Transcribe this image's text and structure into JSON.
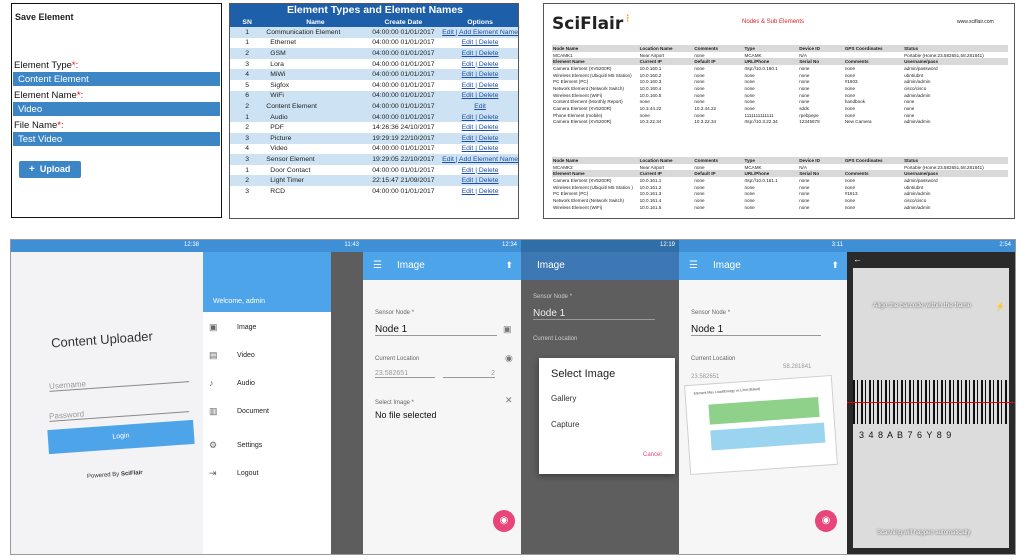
{
  "save_form": {
    "title": "Save Element",
    "fields": [
      {
        "label": "Element Type",
        "value": "Content Element"
      },
      {
        "label": "Element Name",
        "value": "Video"
      },
      {
        "label": "File Name",
        "value": "Test Video"
      }
    ],
    "required_mark": "*:",
    "upload_label": "Upload",
    "upload_icon": "plus-icon"
  },
  "types_table": {
    "title": "Element Types and Element Names",
    "columns": [
      "SN",
      "Name",
      "Create Date",
      "Options"
    ],
    "rows": [
      {
        "sn": "1",
        "toggle": "▾",
        "name": "Communication Element",
        "date": "04:00:00 01/01/2017",
        "options": "Edit | Add Element Name",
        "group": true
      },
      {
        "sn": "1",
        "name": "Ethernet",
        "date": "04:00:00 01/01/2017",
        "options": "Edit | Delete"
      },
      {
        "sn": "2",
        "name": "GSM",
        "date": "04:00:00 01/01/2017",
        "options": "Edit | Delete"
      },
      {
        "sn": "3",
        "name": "Lora",
        "date": "04:00:00 01/01/2017",
        "options": "Edit | Delete"
      },
      {
        "sn": "4",
        "name": "MiWi",
        "date": "04:00:00 01/01/2017",
        "options": "Edit | Delete"
      },
      {
        "sn": "5",
        "name": "Sigfox",
        "date": "04:00:00 01/01/2017",
        "options": "Edit | Delete"
      },
      {
        "sn": "6",
        "name": "WiFi",
        "date": "04:00:00 01/01/2017",
        "options": "Edit | Delete"
      },
      {
        "sn": "2",
        "toggle": "▾",
        "name": "Content Element",
        "date": "04:00:00 01/01/2017",
        "options": "Edit",
        "group": true
      },
      {
        "sn": "1",
        "name": "Audio",
        "date": "04:00:00 01/01/2017",
        "options": "Edit | Delete"
      },
      {
        "sn": "2",
        "name": "PDF",
        "date": "14:26:36 24/10/2017",
        "options": "Edit | Delete"
      },
      {
        "sn": "3",
        "name": "Picture",
        "date": "19:29:19 22/10/2017",
        "options": "Edit | Delete"
      },
      {
        "sn": "4",
        "name": "Video",
        "date": "04:00:00 01/01/2017",
        "options": "Edit | Delete"
      },
      {
        "sn": "3",
        "toggle": "▾",
        "name": "Sensor Element",
        "date": "19:29:05 22/10/2017",
        "options": "Edit | Add Element Name",
        "group": true
      },
      {
        "sn": "1",
        "name": "Door Contact",
        "date": "04:00:00 01/01/2017",
        "options": "Edit | Delete"
      },
      {
        "sn": "2",
        "name": "Light Timer",
        "date": "22:15:47 21/09/2017",
        "options": "Edit | Delete"
      },
      {
        "sn": "3",
        "name": "RCD",
        "date": "04:00:00 01/01/2017",
        "options": "Edit | Delete"
      }
    ]
  },
  "report": {
    "logo": "SciFlair",
    "title": "Nodes & Sub Elements",
    "website": "www.sciflair.com",
    "blocks": [
      {
        "node_header": [
          "Node Name",
          "Location Name",
          "Comments",
          "Type",
          "Device ID",
          "GPS Coordinates",
          "Status"
        ],
        "node_row": [
          "MCAMK1",
          "Near Airport",
          "none",
          "MCAMK",
          "N/A",
          "",
          "Portable (Home:23.582651,58.281841)"
        ],
        "el_header": [
          "Element Name",
          "Current IP",
          "Default IP",
          "URL/Phone",
          "Serial No",
          "Comments",
          "Username/pass"
        ],
        "rows": [
          [
            "Camera Element (XV5200R)",
            "10.0.160.1",
            "none",
            "rtsp://10.0.160.1",
            "none",
            "none",
            "admin/password"
          ],
          [
            "Wireless Element (Ubiquiti M5 Station)",
            "10.0.160.2",
            "none",
            "none",
            "none",
            "none",
            "ubnt/ubnt"
          ],
          [
            "PC Element (PC)",
            "10.0.160.3",
            "none",
            "none",
            "none",
            "#1603",
            "admin/admin"
          ],
          [
            "Network Element (Network Switch)",
            "10.0.160.4",
            "none",
            "none",
            "none",
            "none",
            "cisco/cisco"
          ],
          [
            "Wireless Element (WiFi)",
            "10.0.160.5",
            "none",
            "none",
            "none",
            "none",
            "admin/admin"
          ],
          [
            "Content Element (Monthly Report)",
            "none",
            "none",
            "none",
            "none",
            "handbook",
            "none"
          ],
          [
            "Camera Element (XV5200R)",
            "10.3.44.22",
            "10.3.44.22",
            "none",
            "sdds",
            "none",
            "none"
          ],
          [
            "Phone Element (mobile)",
            "none",
            "none",
            "1111111111111",
            "rpebpepe",
            "none",
            "none"
          ],
          [
            "Camera Element (XV5200R)",
            "10.3.22.34",
            "10.3.22.34",
            "rtsp://10.3.22.34",
            "12345678",
            "New Camera",
            "admin/admin"
          ]
        ]
      },
      {
        "node_header": [
          "Node Name",
          "Location Name",
          "Comments",
          "Type",
          "Device ID",
          "GPS Coordinates",
          "Status"
        ],
        "node_row": [
          "MCAMK2",
          "Near Airport",
          "none",
          "MCAMK",
          "N/A",
          "",
          "Portable (Home:23.582651,58.281841)"
        ],
        "el_header": [
          "Element Name",
          "Current IP",
          "Default IP",
          "URL/Phone",
          "Serial No",
          "Comments",
          "Username/pass"
        ],
        "rows": [
          [
            "Camera Element (XV5200R)",
            "10.0.161.1",
            "none",
            "rtsp://10.0.161.1",
            "none",
            "none",
            "admin/password"
          ],
          [
            "Wireless Element (Ubiquiti M5 Station )",
            "10.0.161.2",
            "none",
            "none",
            "none",
            "none",
            "ubnt/ubnt"
          ],
          [
            "PC Element (PC)",
            "10.0.161.3",
            "none",
            "none",
            "none",
            "#1613",
            "admin/admin"
          ],
          [
            "Network Element (Network Switch)",
            "10.0.161.4",
            "none",
            "none",
            "none",
            "none",
            "cisco/cisco"
          ],
          [
            "Wireless Element (WiFi)",
            "10.0.161.5",
            "none",
            "none",
            "none",
            "none",
            "admin/admin"
          ]
        ]
      }
    ]
  },
  "phones": {
    "login": {
      "time": "12:38",
      "title": "Content Uploader",
      "username_placeholder": "Username",
      "password_placeholder": "Password",
      "login_label": "Login",
      "powered_by": "Powered By",
      "brand": "SciFlair"
    },
    "drawer": {
      "time": "11:43",
      "welcome": "Welcome, admin",
      "items": [
        {
          "icon": "image-icon",
          "label": "Image"
        },
        {
          "icon": "video-icon",
          "label": "Video"
        },
        {
          "icon": "audio-icon",
          "label": "Audio"
        },
        {
          "icon": "document-icon",
          "label": "Document"
        },
        {
          "icon": "gear-icon",
          "label": "Settings"
        },
        {
          "icon": "logout-icon",
          "label": "Logout"
        }
      ]
    },
    "image_form": {
      "time": "12:34",
      "title": "Image",
      "node_label": "Sensor Node *",
      "node_value": "Node 1",
      "location_label": "Current Location",
      "location_value": "23.582651",
      "location_value2": "2",
      "image_label": "Select Image *",
      "image_value": "No file selected"
    },
    "select_dialog": {
      "time": "12:19",
      "title": "Image",
      "node_label": "Sensor Node *",
      "node_value": "Node 1",
      "location_label": "Current Location",
      "dialog_title": "Select Image",
      "options": [
        "Gallery",
        "Capture"
      ],
      "cancel": "Cancel"
    },
    "preview": {
      "time": "3:11",
      "title": "Image",
      "node_label": "Sensor Node *",
      "node_value": "Node 1",
      "location_label": "Current Location",
      "location_value": "23.582651",
      "location_value2": "58.281841",
      "chart_caption": "Element Max Load/Energy vs Limit (Rated)"
    },
    "scanner": {
      "time": "2:54",
      "hint": "Align the barcode within the frame",
      "digits": "3 4 8 A B 7 6 Y 8 9",
      "footer": "Scanning will happen automatically"
    }
  },
  "colors": {
    "primary": "#3d86c6",
    "table_head": "#1d5fa8",
    "row_alt": "#cde3f3",
    "app_bar": "#4ea4e8",
    "fab": "#e8457a",
    "accent_red": "#e00000"
  }
}
